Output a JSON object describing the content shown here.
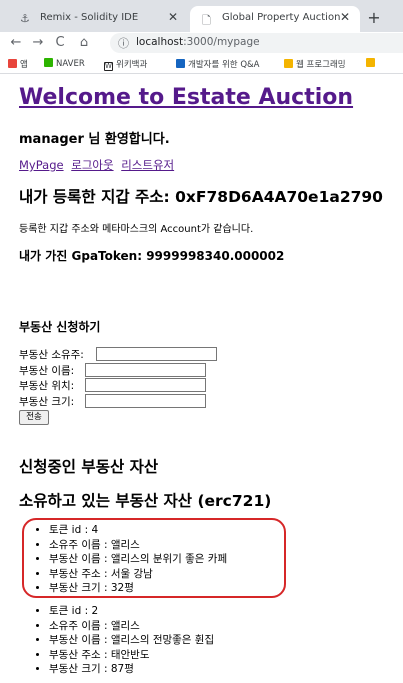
{
  "browser": {
    "tabs": [
      {
        "title": "Remix - Solidity IDE",
        "icon": "remix-icon"
      },
      {
        "title": "Global Property Auction",
        "icon": "document-icon"
      }
    ],
    "close_glyph": "✕",
    "newtab_glyph": "+",
    "url_host": "localhost",
    "url_path": ":3000/mypage",
    "bookmarks": [
      "앱",
      "NAVER",
      "위키백과",
      "개발자를 위한 Q&A",
      "웹 프로그래밍"
    ],
    "bookmark_colors": [
      "#e8453c",
      "#2db400",
      "#222222",
      "#1565c0",
      "#f4b400"
    ],
    "nav_glyphs": {
      "back": "←",
      "forward": "→",
      "reload": "C",
      "home": "⌂",
      "info": "ⓘ"
    }
  },
  "page": {
    "title": "Welcome to Estate Auction",
    "greeting": "manager 님 환영합니다.",
    "links": [
      "MyPage",
      "로그아웃",
      "리스트유저"
    ],
    "wallet_line": "내가 등록한 지갑 주소: 0xF78D6A4A70e1a2790",
    "wallet_note": "등록한 지갑 주소와 메타마스크의 Account가 같습니다.",
    "token_line": "내가 가진 GpaToken: 9999998340.000002",
    "apply": {
      "title": "부동산 신청하기",
      "fields": [
        "부동산 소유주:",
        "부동산 이름:",
        "부동산 위치:",
        "부동산 크기:"
      ],
      "submit": "전송"
    },
    "pending_title": "신청중인 부동산 자산",
    "owned_title": "소유하고 있는 부동산 자산 (erc721)",
    "owned_items": [
      [
        "토큰 id : 4",
        "소유주 이름 : 앨리스",
        "부동산 이름 : 앨리스의 분위기 좋은 카페",
        "부동산 주소 : 서울 강남",
        "부동산 크기 : 32평"
      ],
      [
        "토큰 id : 2",
        "소유주 이름 : 앨리스",
        "부동산 이름 : 앨리스의 전망좋은 휜집",
        "부동산 주소 : 태안반도",
        "부동산 크기 : 87평"
      ]
    ],
    "highlight_color": "#d62728"
  }
}
